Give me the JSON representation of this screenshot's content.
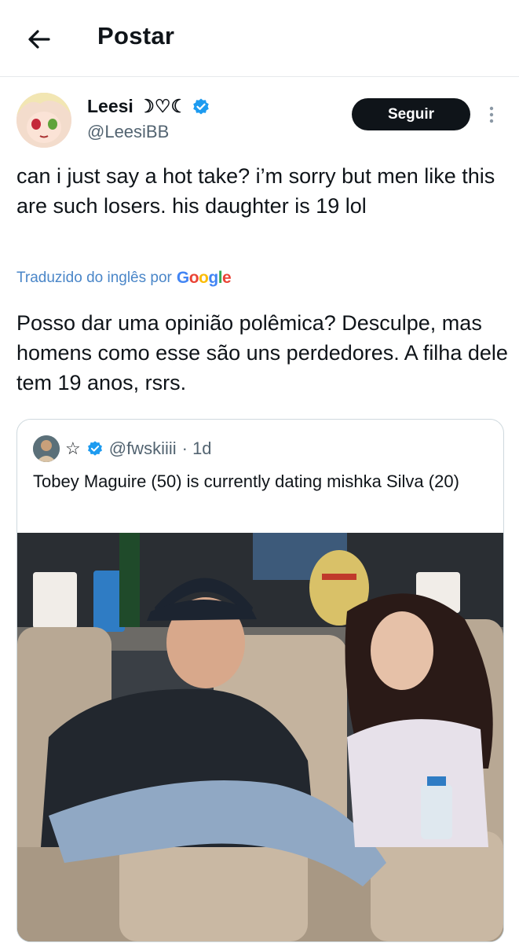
{
  "header": {
    "title": "Postar",
    "back_icon": "arrow-left-icon"
  },
  "author": {
    "name": "Leesi ☽♡☾",
    "handle": "@LeesiBB",
    "verified_color": "#1d9bf0",
    "follow_label": "Seguir"
  },
  "tweet": {
    "text": "can i just say a hot take? i’m sorry but men like this are such losers. his daughter is 19 lol",
    "translated_label": "Traduzido do inglês por",
    "translator_brand": "Google",
    "translation": "Posso dar uma opinião polêmica? Desculpe, mas homens como esse são uns perdedores. A filha dele tem 19 anos, rsrs."
  },
  "quote": {
    "star": "☆",
    "handle": "@fwskiiii",
    "time": "· 1d",
    "text": "Tobey Maguire (50) is currently dating mishka Silva (20)"
  },
  "colors": {
    "accent": "#1d9bf0",
    "link": "#4a86c8",
    "text": "#0f1419",
    "muted": "#536471"
  }
}
